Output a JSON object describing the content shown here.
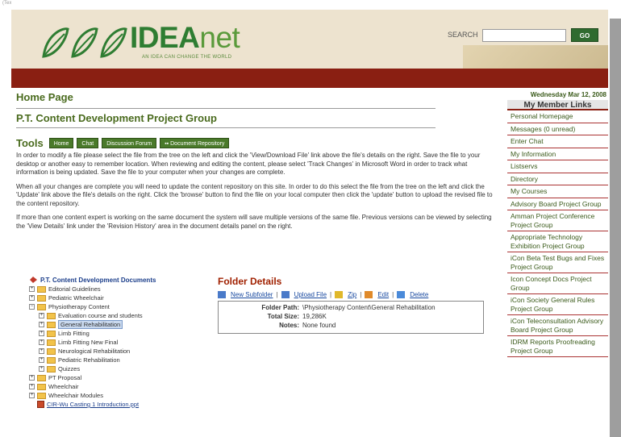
{
  "top_note": "(Text or Your)",
  "logo": {
    "brand_idea": "IDEA",
    "brand_net": "net",
    "tagline": "AN IDEA CAN CHANGE THE WORLD"
  },
  "search": {
    "label": "SEARCH",
    "value": "",
    "placeholder": "",
    "go_label": "GO"
  },
  "page": {
    "home_title": "Home Page",
    "group_title": "P.T. Content Development Project Group"
  },
  "tools": {
    "label": "Tools",
    "buttons": [
      "Home",
      "Chat",
      "Discussion Forum",
      "Document Repository"
    ]
  },
  "instructions": [
    "In order to modify a file please select the file from the tree on the left and click the 'View/Download File' link above the file's details on the right. Save the file to your desktop or another easy to remember location. When reviewing and editing the content, please select 'Track Changes' in Microsoft Word in order to track what information is being updated. Save the file to your computer when your changes are complete.",
    "When all your changes are complete you will need to update the content repository on this site. In order to do this select the file from the tree on the left and click the 'Update' link above the file's details on the right. Click the 'browse' button to find the file on your local computer then click the 'update' button to upload the revised file to the content repository.",
    "If more than one content expert is working on the same document the system will save multiple versions of the same file. Previous versions can be viewed by selecting the 'View Details' link under the 'Revision History' area in the document details panel on the right."
  ],
  "tree": {
    "root": "P.T. Content Development Documents",
    "items": [
      {
        "label": "Editorial Guidelines",
        "level": 1,
        "expander": "+"
      },
      {
        "label": "Pediatric Wheelchair",
        "level": 1,
        "expander": "+"
      },
      {
        "label": "Physiotherapy Content",
        "level": 1,
        "expander": "−"
      },
      {
        "label": "Evaluation course and students",
        "level": 2,
        "expander": "+"
      },
      {
        "label": "General Rehabilitation",
        "level": 2,
        "expander": "+",
        "selected": true
      },
      {
        "label": "Limb Fitting",
        "level": 2,
        "expander": "+"
      },
      {
        "label": "Limb Fitting New Final",
        "level": 2,
        "expander": "+"
      },
      {
        "label": "Neurological Rehabilitation",
        "level": 2,
        "expander": "+"
      },
      {
        "label": "Pediatric Rehabilitation",
        "level": 2,
        "expander": "+"
      },
      {
        "label": "Quizzes",
        "level": 2,
        "expander": "+"
      },
      {
        "label": "PT Proposal",
        "level": 1,
        "expander": "+"
      },
      {
        "label": "Wheelchair",
        "level": 1,
        "expander": "+"
      },
      {
        "label": "Wheelchair Modules",
        "level": 1,
        "expander": "+"
      },
      {
        "label": "CIR-Wu Casting 1 Introduction.ppt",
        "level": 1,
        "expander": "",
        "file": true
      }
    ]
  },
  "folder_details": {
    "title": "Folder Details",
    "actions": [
      "New Subfolder",
      "Upload File",
      "Zip",
      "Edit",
      "Delete"
    ],
    "path_label": "Folder Path:",
    "path": "\\Physiotherapy Content\\General Rehabilitation",
    "size_label": "Total Size:",
    "size": "19,286K",
    "notes_label": "Notes:",
    "notes": "None found"
  },
  "sidebar": {
    "date": "Wednesday Mar 12, 2008",
    "title": "My Member Links",
    "links": [
      "Personal Homepage",
      "Messages (0 unread)",
      "Enter Chat",
      "My Information",
      "Listservs",
      "Directory",
      "My Courses",
      "Advisory Board Project Group",
      "Amman Project Conference Project Group",
      "Appropriate Technology Exhibition Project Group",
      "iCon Beta Test Bugs and Fixes Project Group",
      "Icon Concept Docs Project Group",
      "iCon Society General Rules Project Group",
      "iCon Teleconsultation Advisory Board Project Group",
      "IDRM Reports Proofreading Project Group"
    ]
  },
  "colors": {
    "header_bg": "#ede3cf",
    "red_bar": "#8a1f12",
    "green_title": "#4a6b1e",
    "folder_title": "#a02000"
  }
}
